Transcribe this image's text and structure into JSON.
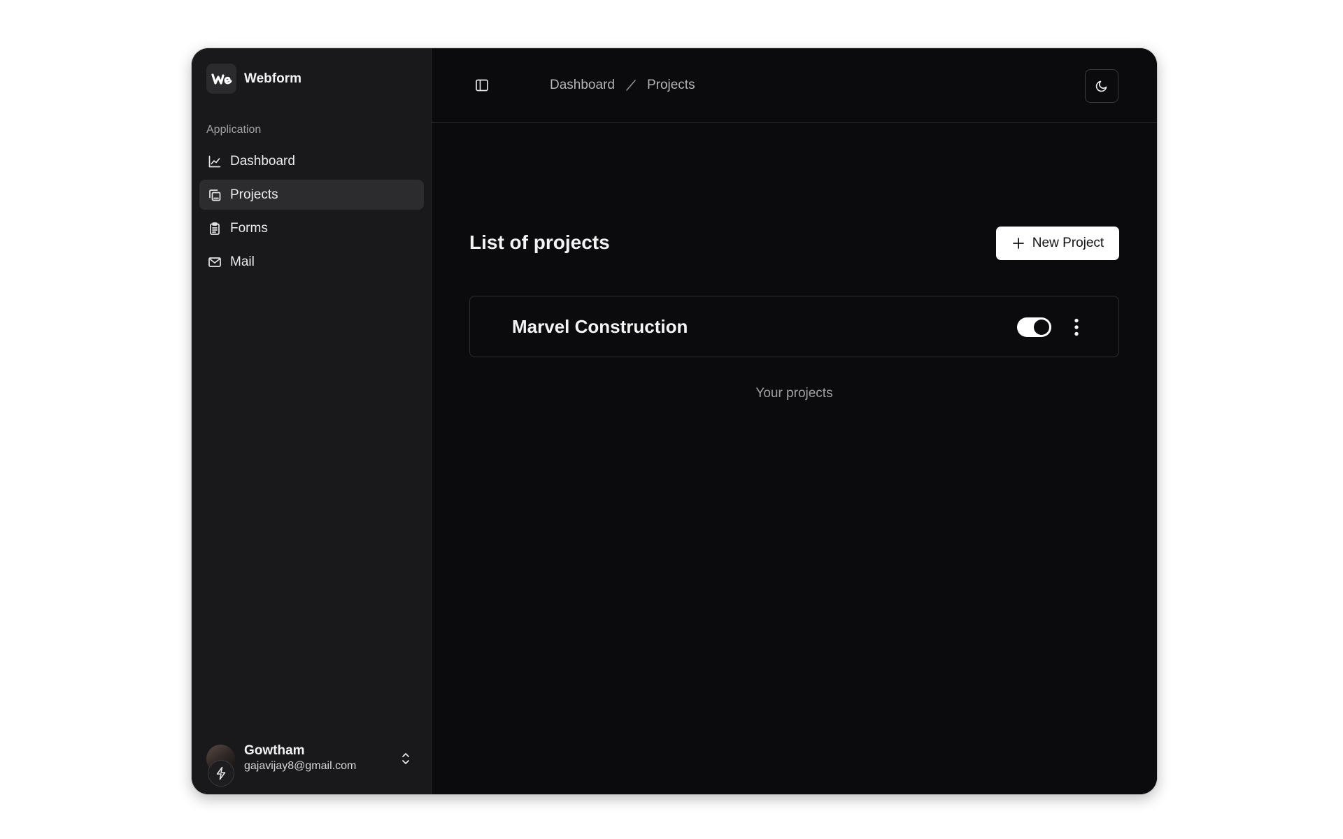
{
  "brand": {
    "name": "Webform",
    "logo_text": "We",
    "logo_icon": "webform-logo-icon"
  },
  "sidebar": {
    "section_label": "Application",
    "items": [
      {
        "label": "Dashboard",
        "icon": "line-chart-icon",
        "active": false
      },
      {
        "label": "Projects",
        "icon": "projects-icon",
        "active": true
      },
      {
        "label": "Forms",
        "icon": "clipboard-icon",
        "active": false
      },
      {
        "label": "Mail",
        "icon": "mail-icon",
        "active": false
      }
    ]
  },
  "user": {
    "name": "Gowtham",
    "email": "gajavijay8@gmail.com",
    "badge_icon": "lightning-icon",
    "chevron_icon": "chevrons-up-down-icon"
  },
  "header": {
    "toggle_icon": "sidebar-toggle-icon",
    "breadcrumb": [
      "Dashboard",
      "Projects"
    ],
    "theme_icon": "moon-icon"
  },
  "main": {
    "title": "List of projects",
    "new_project_label": "New Project",
    "projects": [
      {
        "name": "Marvel Construction",
        "enabled": true
      }
    ],
    "caption": "Your projects"
  },
  "colors": {
    "background": "#0b0b0d",
    "sidebar": "#19191b",
    "active_item": "#2c2c2f",
    "text": "#f4f4f5",
    "muted": "#a1a1a6",
    "button_bg": "#ffffff"
  }
}
